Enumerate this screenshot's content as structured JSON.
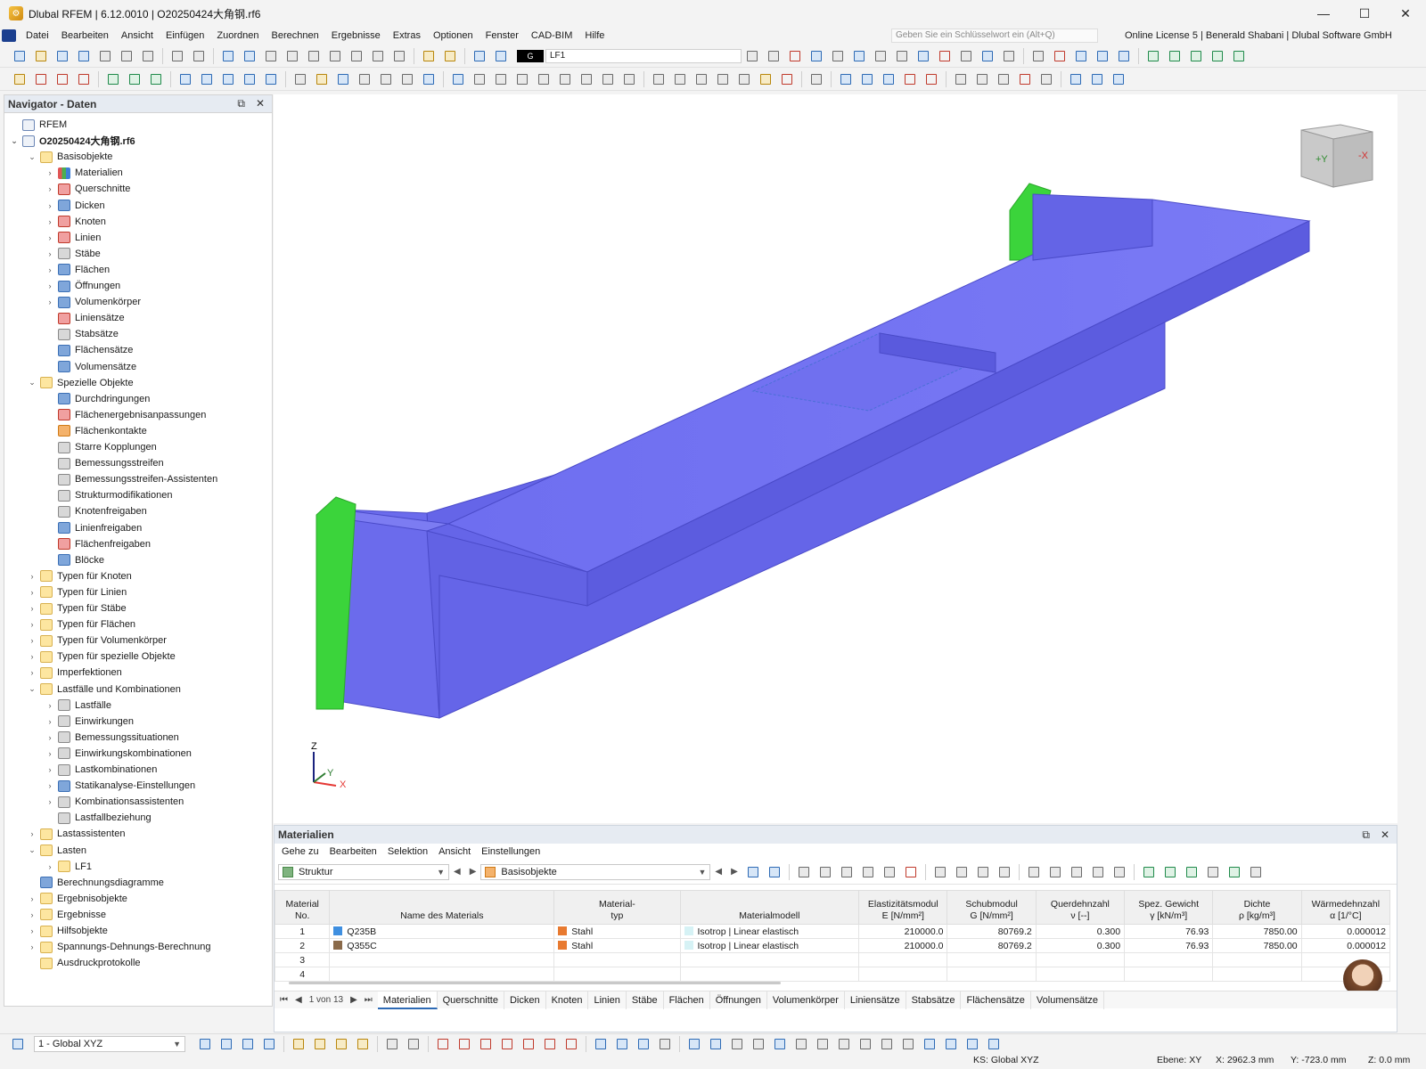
{
  "app": {
    "title": "Dlubal RFEM | 6.12.0010 | O20250424大角钢.rf6",
    "window_controls": {
      "minimize": "—",
      "maximize": "☐",
      "close": "✕"
    }
  },
  "menu": {
    "items": [
      "Datei",
      "Bearbeiten",
      "Ansicht",
      "Einfügen",
      "Zuordnen",
      "Berechnen",
      "Ergebnisse",
      "Extras",
      "Optionen",
      "Fenster",
      "CAD-BIM",
      "Hilfe"
    ],
    "search_placeholder": "Geben Sie ein Schlüsselwort ein (Alt+Q)",
    "license": "Online License 5 | Benerald Shabani | Dlubal Software GmbH"
  },
  "toolbar": {
    "loadcase_tag": "G",
    "loadcase": "LF1"
  },
  "navigator": {
    "title": "Navigator - Daten",
    "tree": [
      {
        "label": "RFEM",
        "level": 0,
        "tog": "",
        "icon": "doc"
      },
      {
        "label": "O20250424大角钢.rf6",
        "level": 0,
        "tog": "v",
        "icon": "doc",
        "bold": true
      },
      {
        "label": "Basisobjekte",
        "level": 1,
        "tog": "v",
        "icon": "folder"
      },
      {
        "label": "Materialien",
        "level": 2,
        "tog": ">",
        "icon": "multi"
      },
      {
        "label": "Querschnitte",
        "level": 2,
        "tog": ">",
        "icon": "red"
      },
      {
        "label": "Dicken",
        "level": 2,
        "tog": ">",
        "icon": "blue"
      },
      {
        "label": "Knoten",
        "level": 2,
        "tog": ">",
        "icon": "red"
      },
      {
        "label": "Linien",
        "level": 2,
        "tog": ">",
        "icon": "red"
      },
      {
        "label": "Stäbe",
        "level": 2,
        "tog": ">",
        "icon": "gray"
      },
      {
        "label": "Flächen",
        "level": 2,
        "tog": ">",
        "icon": "blue"
      },
      {
        "label": "Öffnungen",
        "level": 2,
        "tog": ">",
        "icon": "blue"
      },
      {
        "label": "Volumenkörper",
        "level": 2,
        "tog": ">",
        "icon": "blue"
      },
      {
        "label": "Liniensätze",
        "level": 2,
        "tog": "",
        "icon": "red"
      },
      {
        "label": "Stabsätze",
        "level": 2,
        "tog": "",
        "icon": "gray"
      },
      {
        "label": "Flächensätze",
        "level": 2,
        "tog": "",
        "icon": "blue"
      },
      {
        "label": "Volumensätze",
        "level": 2,
        "tog": "",
        "icon": "blue"
      },
      {
        "label": "Spezielle Objekte",
        "level": 1,
        "tog": "v",
        "icon": "folder"
      },
      {
        "label": "Durchdringungen",
        "level": 2,
        "tog": "",
        "icon": "blue"
      },
      {
        "label": "Flächenergebnisanpassungen",
        "level": 2,
        "tog": "",
        "icon": "red"
      },
      {
        "label": "Flächenkontakte",
        "level": 2,
        "tog": "",
        "icon": "orange"
      },
      {
        "label": "Starre Kopplungen",
        "level": 2,
        "tog": "",
        "icon": "gray"
      },
      {
        "label": "Bemessungsstreifen",
        "level": 2,
        "tog": "",
        "icon": "gray"
      },
      {
        "label": "Bemessungsstreifen-Assistenten",
        "level": 2,
        "tog": "",
        "icon": "gray"
      },
      {
        "label": "Strukturmodifikationen",
        "level": 2,
        "tog": "",
        "icon": "gray"
      },
      {
        "label": "Knotenfreigaben",
        "level": 2,
        "tog": "",
        "icon": "gray"
      },
      {
        "label": "Linienfreigaben",
        "level": 2,
        "tog": "",
        "icon": "blue"
      },
      {
        "label": "Flächenfreigaben",
        "level": 2,
        "tog": "",
        "icon": "red"
      },
      {
        "label": "Blöcke",
        "level": 2,
        "tog": "",
        "icon": "blue"
      },
      {
        "label": "Typen für Knoten",
        "level": 1,
        "tog": ">",
        "icon": "folder"
      },
      {
        "label": "Typen für Linien",
        "level": 1,
        "tog": ">",
        "icon": "folder"
      },
      {
        "label": "Typen für Stäbe",
        "level": 1,
        "tog": ">",
        "icon": "folder"
      },
      {
        "label": "Typen für Flächen",
        "level": 1,
        "tog": ">",
        "icon": "folder"
      },
      {
        "label": "Typen für Volumenkörper",
        "level": 1,
        "tog": ">",
        "icon": "folder"
      },
      {
        "label": "Typen für spezielle Objekte",
        "level": 1,
        "tog": ">",
        "icon": "folder"
      },
      {
        "label": "Imperfektionen",
        "level": 1,
        "tog": ">",
        "icon": "folder"
      },
      {
        "label": "Lastfälle und Kombinationen",
        "level": 1,
        "tog": "v",
        "icon": "folder"
      },
      {
        "label": "Lastfälle",
        "level": 2,
        "tog": ">",
        "icon": "gray"
      },
      {
        "label": "Einwirkungen",
        "level": 2,
        "tog": ">",
        "icon": "gray"
      },
      {
        "label": "Bemessungssituationen",
        "level": 2,
        "tog": ">",
        "icon": "gray"
      },
      {
        "label": "Einwirkungskombinationen",
        "level": 2,
        "tog": ">",
        "icon": "gray"
      },
      {
        "label": "Lastkombinationen",
        "level": 2,
        "tog": ">",
        "icon": "gray"
      },
      {
        "label": "Statikanalyse-Einstellungen",
        "level": 2,
        "tog": ">",
        "icon": "blue"
      },
      {
        "label": "Kombinationsassistenten",
        "level": 2,
        "tog": ">",
        "icon": "gray"
      },
      {
        "label": "Lastfallbeziehung",
        "level": 2,
        "tog": "",
        "icon": "gray"
      },
      {
        "label": "Lastassistenten",
        "level": 1,
        "tog": ">",
        "icon": "folder"
      },
      {
        "label": "Lasten",
        "level": 1,
        "tog": "v",
        "icon": "folder"
      },
      {
        "label": "LF1",
        "level": 2,
        "tog": ">",
        "icon": "folder"
      },
      {
        "label": "Berechnungsdiagramme",
        "level": 1,
        "tog": "",
        "icon": "blue"
      },
      {
        "label": "Ergebnisobjekte",
        "level": 1,
        "tog": ">",
        "icon": "folder"
      },
      {
        "label": "Ergebnisse",
        "level": 1,
        "tog": ">",
        "icon": "folder"
      },
      {
        "label": "Hilfsobjekte",
        "level": 1,
        "tog": ">",
        "icon": "folder"
      },
      {
        "label": "Spannungs-Dehnungs-Berechnung",
        "level": 1,
        "tog": ">",
        "icon": "folder"
      },
      {
        "label": "Ausdruckprotokolle",
        "level": 1,
        "tog": "",
        "icon": "folder"
      }
    ]
  },
  "viewport": {
    "cube_faces": {
      "front": "+Y",
      "side": "-X"
    },
    "axes": {
      "z": "Z",
      "y": "Y",
      "x": "X"
    },
    "model_color": "#6b6bec",
    "support_color": "#3bd43b"
  },
  "materials_panel": {
    "title": "Materialien",
    "menu": [
      "Gehe zu",
      "Bearbeiten",
      "Selektion",
      "Ansicht",
      "Einstellungen"
    ],
    "combo_left": "Struktur",
    "combo_right": "Basisobjekte",
    "columns": [
      {
        "l1": "Material",
        "l2": "No."
      },
      {
        "l1": "",
        "l2": "Name des Materials"
      },
      {
        "l1": "Material-",
        "l2": "typ"
      },
      {
        "l1": "",
        "l2": "Materialmodell"
      },
      {
        "l1": "Elastizitätsmodul",
        "l2": "E [N/mm²]"
      },
      {
        "l1": "Schubmodul",
        "l2": "G [N/mm²]"
      },
      {
        "l1": "Querdehnzahl",
        "l2": "ν [--]"
      },
      {
        "l1": "Spez. Gewicht",
        "l2": "γ [kN/m³]"
      },
      {
        "l1": "Dichte",
        "l2": "ρ [kg/m³]"
      },
      {
        "l1": "Wärmedehnzahl",
        "l2": "α [1/°C]"
      }
    ],
    "rows": [
      {
        "no": "1",
        "name": "Q235B",
        "name_color": "#3f8fe0",
        "type": "Stahl",
        "type_color": "#e87a30",
        "model": "Isotrop | Linear elastisch",
        "e": "210000.0",
        "g": "80769.2",
        "nu": "0.300",
        "gamma": "76.93",
        "rho": "7850.00",
        "alpha": "0.000012"
      },
      {
        "no": "2",
        "name": "Q355C",
        "name_color": "#8a6a4a",
        "type": "Stahl",
        "type_color": "#e87a30",
        "model": "Isotrop | Linear elastisch",
        "e": "210000.0",
        "g": "80769.2",
        "nu": "0.300",
        "gamma": "76.93",
        "rho": "7850.00",
        "alpha": "0.000012"
      },
      {
        "no": "3",
        "name": "",
        "type": "",
        "model": "",
        "e": "",
        "g": "",
        "nu": "",
        "gamma": "",
        "rho": "",
        "alpha": ""
      },
      {
        "no": "4",
        "name": "",
        "type": "",
        "model": "",
        "e": "",
        "g": "",
        "nu": "",
        "gamma": "",
        "rho": "",
        "alpha": ""
      }
    ],
    "pager": "1 von 13",
    "tabs": [
      "Materialien",
      "Querschnitte",
      "Dicken",
      "Knoten",
      "Linien",
      "Stäbe",
      "Flächen",
      "Öffnungen",
      "Volumenkörper",
      "Liniensätze",
      "Stabsätze",
      "Flächensätze",
      "Volumensätze"
    ],
    "active_tab": "Materialien"
  },
  "bottom": {
    "coord_system": "1 - Global XYZ"
  },
  "status": {
    "ks": "KS: Global XYZ",
    "plane": "Ebene: XY",
    "x": "X: 2962.3 mm",
    "y": "Y: -723.0 mm",
    "z": "Z: 0.0 mm"
  }
}
